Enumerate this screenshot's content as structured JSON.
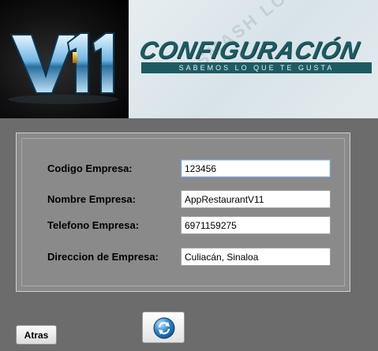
{
  "header": {
    "logo_text": "V11",
    "banner_title": "CONFIGURACIÓN",
    "banner_tagline": "SABEMOS LO QUE TE GUSTA",
    "watermark": "SMASH LOGO"
  },
  "form": {
    "fields": [
      {
        "label": "Codigo Empresa:",
        "value": "123456"
      },
      {
        "label": "Nombre Empresa:",
        "value": "AppRestaurantV11"
      },
      {
        "label": "Telefono Empresa:",
        "value": "6971159275"
      },
      {
        "label": "Direccion de Empresa:",
        "value": "Culiacán, Sinaloa"
      }
    ]
  },
  "buttons": {
    "back_label": "Atras",
    "save_icon": "refresh-save-icon"
  },
  "colors": {
    "background": "#6c6c6c",
    "panel": "#8a8a8a",
    "banner_teal": "#1d5b63",
    "icon_blue": "#2d86c9"
  }
}
